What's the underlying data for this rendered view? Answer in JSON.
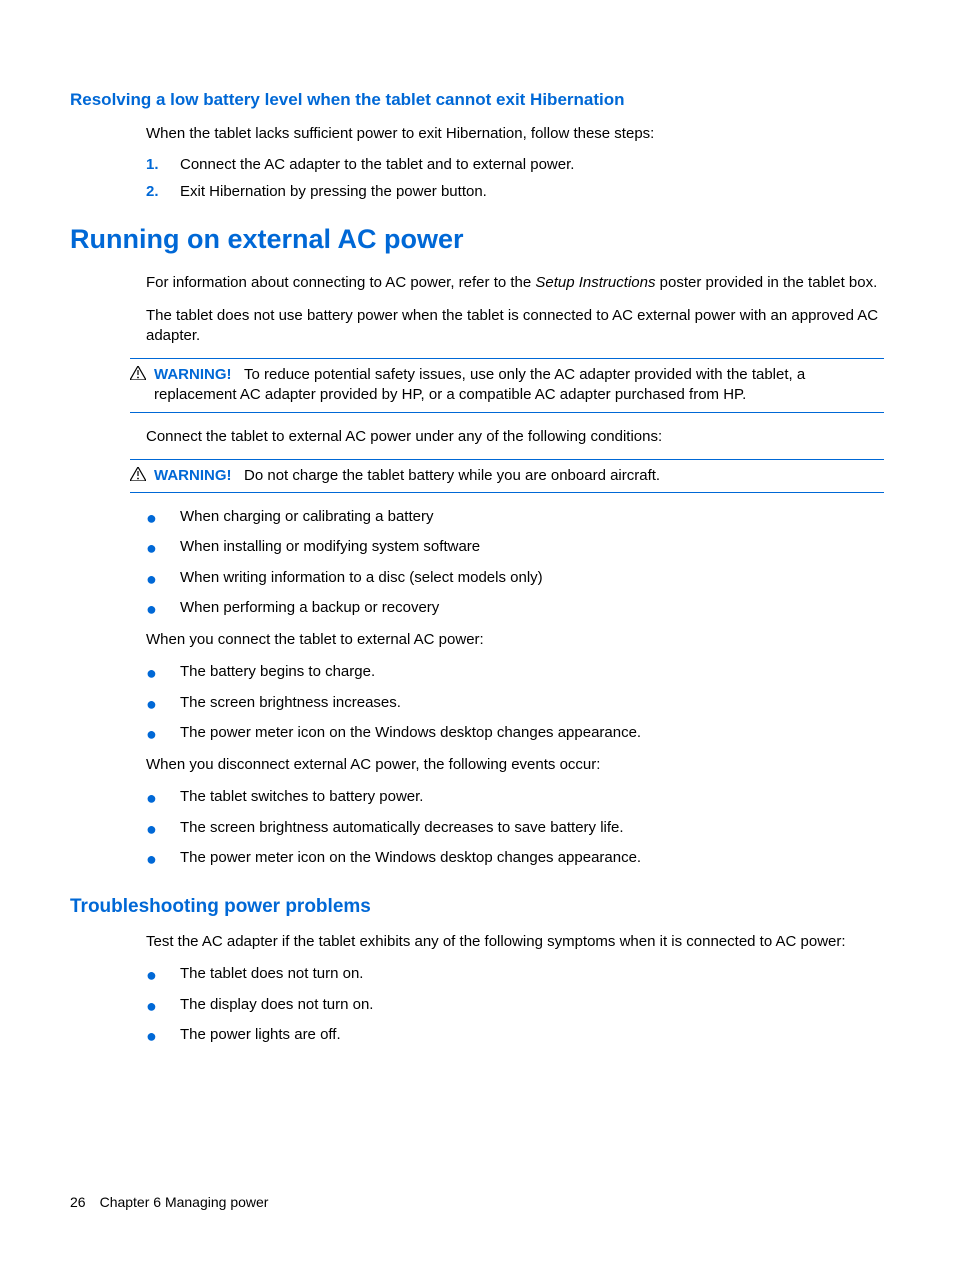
{
  "section1": {
    "heading": "Resolving a low battery level when the tablet cannot exit Hibernation",
    "intro": "When the tablet lacks sufficient power to exit Hibernation, follow these steps:",
    "steps": [
      {
        "num": "1.",
        "text": "Connect the AC adapter to the tablet and to external power."
      },
      {
        "num": "2.",
        "text": "Exit Hibernation by pressing the power button."
      }
    ]
  },
  "section2": {
    "heading": "Running on external AC power",
    "para1_before": "For information about connecting to AC power, refer to the ",
    "para1_italic": "Setup Instructions",
    "para1_after": " poster provided in the tablet box.",
    "para2": "The tablet does not use battery power when the tablet is connected to AC external power with an approved AC adapter.",
    "warning1_label": "WARNING!",
    "warning1_text": "To reduce potential safety issues, use only the AC adapter provided with the tablet, a replacement AC adapter provided by HP, or a compatible AC adapter purchased from HP.",
    "para3": "Connect the tablet to external AC power under any of the following conditions:",
    "warning2_label": "WARNING!",
    "warning2_text": "Do not charge the tablet battery while you are onboard aircraft.",
    "conditions": [
      "When charging or calibrating a battery",
      "When installing or modifying system software",
      "When writing information to a disc (select models only)",
      "When performing a backup or recovery"
    ],
    "para4": "When you connect the tablet to external AC power:",
    "connected": [
      "The battery begins to charge.",
      "The screen brightness increases.",
      "The power meter icon on the Windows desktop changes appearance."
    ],
    "para5": "When you disconnect external AC power, the following events occur:",
    "disconnected": [
      "The tablet switches to battery power.",
      "The screen brightness automatically decreases to save battery life.",
      "The power meter icon on the Windows desktop changes appearance."
    ]
  },
  "section3": {
    "heading": "Troubleshooting power problems",
    "intro": "Test the AC adapter if the tablet exhibits any of the following symptoms when it is connected to AC power:",
    "symptoms": [
      "The tablet does not turn on.",
      "The display does not turn on.",
      "The power lights are off."
    ]
  },
  "footer": {
    "pagenum": "26",
    "chapter": "Chapter 6   Managing power"
  }
}
